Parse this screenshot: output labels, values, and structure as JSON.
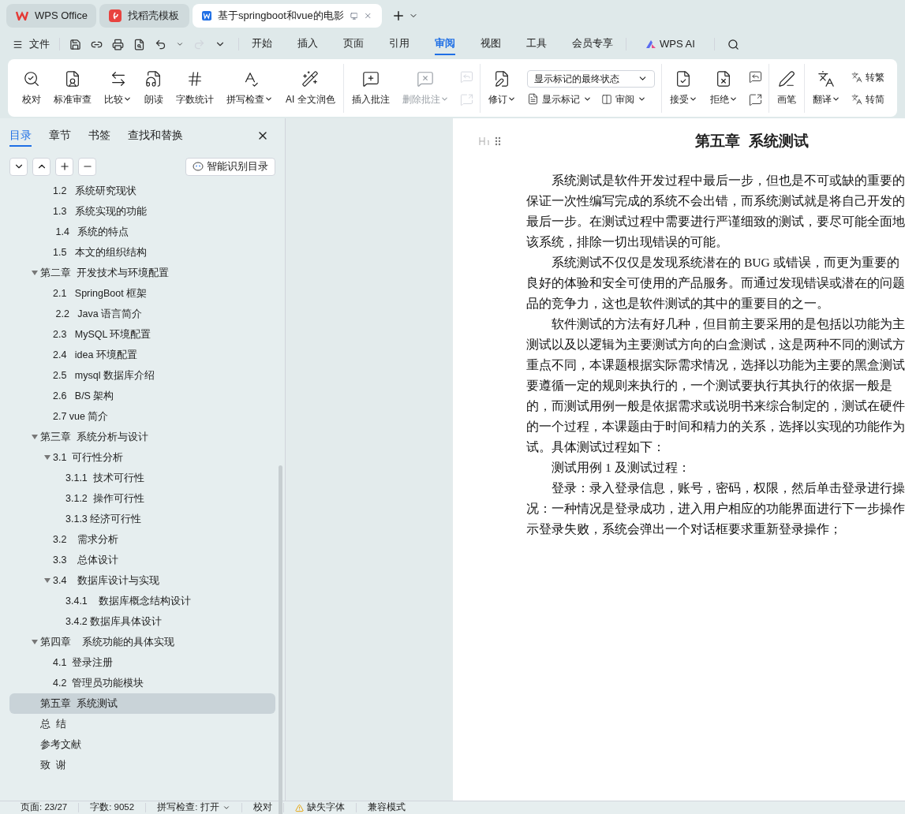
{
  "browser_tabs": [
    {
      "label": "WPS Office",
      "selected": false
    },
    {
      "label": "找稻壳模板",
      "selected": false
    },
    {
      "label": "基于springboot和vue的电影",
      "selected": true
    }
  ],
  "menu": {
    "file": "文件",
    "tabs": [
      {
        "label": "开始",
        "selected": false
      },
      {
        "label": "插入",
        "selected": false
      },
      {
        "label": "页面",
        "selected": false
      },
      {
        "label": "引用",
        "selected": false
      },
      {
        "label": "审阅",
        "selected": true
      },
      {
        "label": "视图",
        "selected": false
      },
      {
        "label": "工具",
        "selected": false
      },
      {
        "label": "会员专享",
        "selected": false
      }
    ],
    "ai": "WPS AI"
  },
  "ribbon": [
    {
      "items": [
        {
          "kind": "large",
          "label": "校对",
          "dropdown": false,
          "disabled": false
        },
        {
          "kind": "large",
          "label": "标准审查",
          "dropdown": false,
          "disabled": false
        },
        {
          "kind": "large",
          "label": "比较",
          "dropdown": true,
          "disabled": false
        },
        {
          "kind": "large",
          "label": "朗读",
          "dropdown": false,
          "disabled": false
        },
        {
          "kind": "large",
          "label": "字数统计",
          "dropdown": false,
          "disabled": false
        },
        {
          "kind": "large",
          "label": "拼写检查",
          "dropdown": true,
          "disabled": false
        },
        {
          "kind": "large",
          "label": "AI 全文润色",
          "dropdown": false,
          "disabled": false
        }
      ]
    },
    {
      "items": [
        {
          "kind": "large",
          "label": "插入批注",
          "dropdown": false,
          "disabled": false
        },
        {
          "kind": "large",
          "label": "删除批注",
          "dropdown": true,
          "disabled": true
        },
        {
          "kind": "icon_pair",
          "disabled": true
        }
      ]
    },
    {
      "items": [
        {
          "kind": "large",
          "label": "修订",
          "dropdown": true,
          "disabled": false
        },
        {
          "kind": "review",
          "select": "显示标记的最终状态",
          "buttons": [
            {
              "label": "显示标记",
              "dropdown": true
            },
            {
              "label": "审阅",
              "dropdown": true
            }
          ]
        }
      ]
    },
    {
      "items": [
        {
          "kind": "large",
          "label": "接受",
          "dropdown": true,
          "disabled": false
        },
        {
          "kind": "large",
          "label": "拒绝",
          "dropdown": true,
          "disabled": false
        },
        {
          "kind": "icon_pair",
          "disabled": false
        }
      ]
    },
    {
      "items": [
        {
          "kind": "large",
          "label": "画笔",
          "dropdown": false,
          "disabled": false
        }
      ]
    },
    {
      "items": [
        {
          "kind": "large",
          "label": "翻译",
          "dropdown": true,
          "disabled": false
        },
        {
          "kind": "text_pair",
          "labels": [
            "转繁",
            "转简"
          ]
        }
      ]
    }
  ],
  "nav_panel": {
    "tabs": [
      {
        "label": "目录",
        "selected": true
      },
      {
        "label": "章节",
        "selected": false
      },
      {
        "label": "书签",
        "selected": false
      },
      {
        "label": "查找和替换",
        "selected": false
      }
    ],
    "smart_button": "智能识别目录",
    "tree": [
      {
        "children": [
          {
            "label": "1.2   系统研究现状",
            "selected": false
          },
          {
            "label": "1.3   系统实现的功能",
            "selected": false
          },
          {
            "label": " 1.4   系统的特点",
            "selected": false
          },
          {
            "label": "1.5   本文的组织结构",
            "selected": false
          }
        ]
      },
      {
        "label": "第二章  开发技术与环境配置",
        "selected": false,
        "expanded": true,
        "children": [
          {
            "label": "2.1   SpringBoot 框架",
            "selected": false
          },
          {
            "label": " 2.2   Java 语言简介",
            "selected": false
          },
          {
            "label": "2.3   MySQL 环境配置",
            "selected": false
          },
          {
            "label": "2.4   idea 环境配置",
            "selected": false
          },
          {
            "label": "2.5   mysql 数据库介绍",
            "selected": false
          },
          {
            "label": "2.6   B/S 架构",
            "selected": false
          },
          {
            "label": "2.7 vue 简介",
            "selected": false
          }
        ]
      },
      {
        "label": "第三章  系统分析与设计",
        "selected": false,
        "expanded": true,
        "children": [
          {
            "label": "3.1  可行性分析",
            "selected": false,
            "expanded": true,
            "children": [
              {
                "label": "3.1.1  技术可行性",
                "selected": false
              },
              {
                "label": "3.1.2  操作可行性",
                "selected": false
              },
              {
                "label": "3.1.3 经济可行性",
                "selected": false
              }
            ]
          },
          {
            "label": "3.2    需求分析",
            "selected": false
          },
          {
            "label": "3.3    总体设计",
            "selected": false
          },
          {
            "label": "3.4    数据库设计与实现",
            "selected": false,
            "expanded": true,
            "children": [
              {
                "label": "3.4.1    数据库概念结构设计",
                "selected": false
              },
              {
                "label": "3.4.2 数据库具体设计",
                "selected": false
              }
            ]
          }
        ]
      },
      {
        "label": "第四章    系统功能的具体实现",
        "selected": false,
        "expanded": true,
        "children": [
          {
            "label": "4.1  登录注册",
            "selected": false
          },
          {
            "label": "4.2  管理员功能模块",
            "selected": false
          }
        ]
      },
      {
        "label": "第五章  系统测试",
        "selected": true
      },
      {
        "label": "总  结",
        "selected": false
      },
      {
        "label": "参考文献",
        "selected": false
      },
      {
        "label": "致  谢",
        "selected": false
      }
    ]
  },
  "document": {
    "heading": "第五章  系统测试",
    "paragraphs": [
      [
        "系统测试是软件开发过程中最后一步，但也是不可或缺的重要的",
        "保证一次性编写完成的系统不会出错，而系统测试就是将自己开发的",
        "最后一步。在测试过程中需要进行严谨细致的测试，要尽可能全面地",
        "该系统，排除一切出现错误的可能。"
      ],
      [
        "系统测试不仅仅是发现系统潜在的 BUG 或错误，而更为重要的",
        "良好的体验和安全可使用的产品服务。而通过发现错误或潜在的问题",
        "品的竞争力，这也是软件测试的其中的重要目的之一。"
      ],
      [
        "软件测试的方法有好几种，但目前主要采用的是包括以功能为主",
        "测试以及以逻辑为主要测试方向的白盒测试，这是两种不同的测试方",
        "重点不同，本课题根据实际需求情况，选择以功能为主要的黑盒测试",
        "要遵循一定的规则来执行的，一个测试要执行其执行的依据一般是",
        "的，而测试用例一般是依据需求或说明书来综合制定的，测试在硬件",
        "的一个过程，本课题由于时间和精力的关系，选择以实现的功能作为",
        "试。具体测试过程如下："
      ],
      [
        "测试用例 1 及测试过程："
      ],
      [
        "登录：录入登录信息，账号，密码，权限，然后单击登录进行操",
        "况：一种情况是登录成功，进入用户相应的功能界面进行下一步操作",
        "示登录失败，系统会弹出一个对话框要求重新登录操作；"
      ]
    ]
  },
  "status_bar": [
    {
      "kind": "text",
      "label": "页面: 23/27"
    },
    {
      "kind": "text",
      "label": "字数: 9052"
    },
    {
      "kind": "dropdown",
      "label": "拼写检查: 打开"
    },
    {
      "kind": "text",
      "label": "校对"
    },
    {
      "kind": "warning",
      "label": "缺失字体"
    },
    {
      "kind": "text",
      "label": "兼容模式"
    }
  ]
}
